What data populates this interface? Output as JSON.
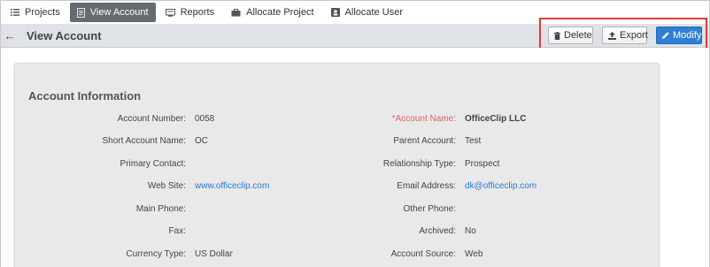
{
  "nav": {
    "items": [
      {
        "label": "Projects",
        "icon": "list-icon",
        "active": false
      },
      {
        "label": "View Account",
        "icon": "document-icon",
        "active": true
      },
      {
        "label": "Reports",
        "icon": "monitor-icon",
        "active": false
      },
      {
        "label": "Allocate Project",
        "icon": "briefcase-icon",
        "active": false
      },
      {
        "label": "Allocate User",
        "icon": "user-card-icon",
        "active": false
      }
    ]
  },
  "toolbar": {
    "title": "View Account",
    "delete_label": "Delete",
    "export_label": "Export",
    "modify_label": "Modify"
  },
  "account": {
    "section_title": "Account Information",
    "left_fields": [
      {
        "label": "Account Number:",
        "value": "0058"
      },
      {
        "label": "Short Account Name:",
        "value": "OC"
      },
      {
        "label": "Primary Contact:",
        "value": ""
      },
      {
        "label": "Web Site:",
        "value": "www.officeclip.com"
      },
      {
        "label": "Main Phone:",
        "value": ""
      },
      {
        "label": "Fax:",
        "value": ""
      },
      {
        "label": "Currency Type:",
        "value": "US Dollar"
      }
    ],
    "right_fields": [
      {
        "label": "*Account Name:",
        "value": "OfficeClip LLC"
      },
      {
        "label": "Parent Account:",
        "value": "Test"
      },
      {
        "label": "Relationship Type:",
        "value": "Prospect"
      },
      {
        "label": "Email Address:",
        "value": "dk@officeclip.com"
      },
      {
        "label": "Other Phone:",
        "value": ""
      },
      {
        "label": "Archived:",
        "value": "No"
      },
      {
        "label": "Account Source:",
        "value": "Web"
      }
    ]
  },
  "colors": {
    "active_nav": "#666b70",
    "modify_button": "#2f7fd6",
    "highlight": "#e03a3a",
    "link": "#2a7ad0",
    "required_label": "#e56060"
  }
}
